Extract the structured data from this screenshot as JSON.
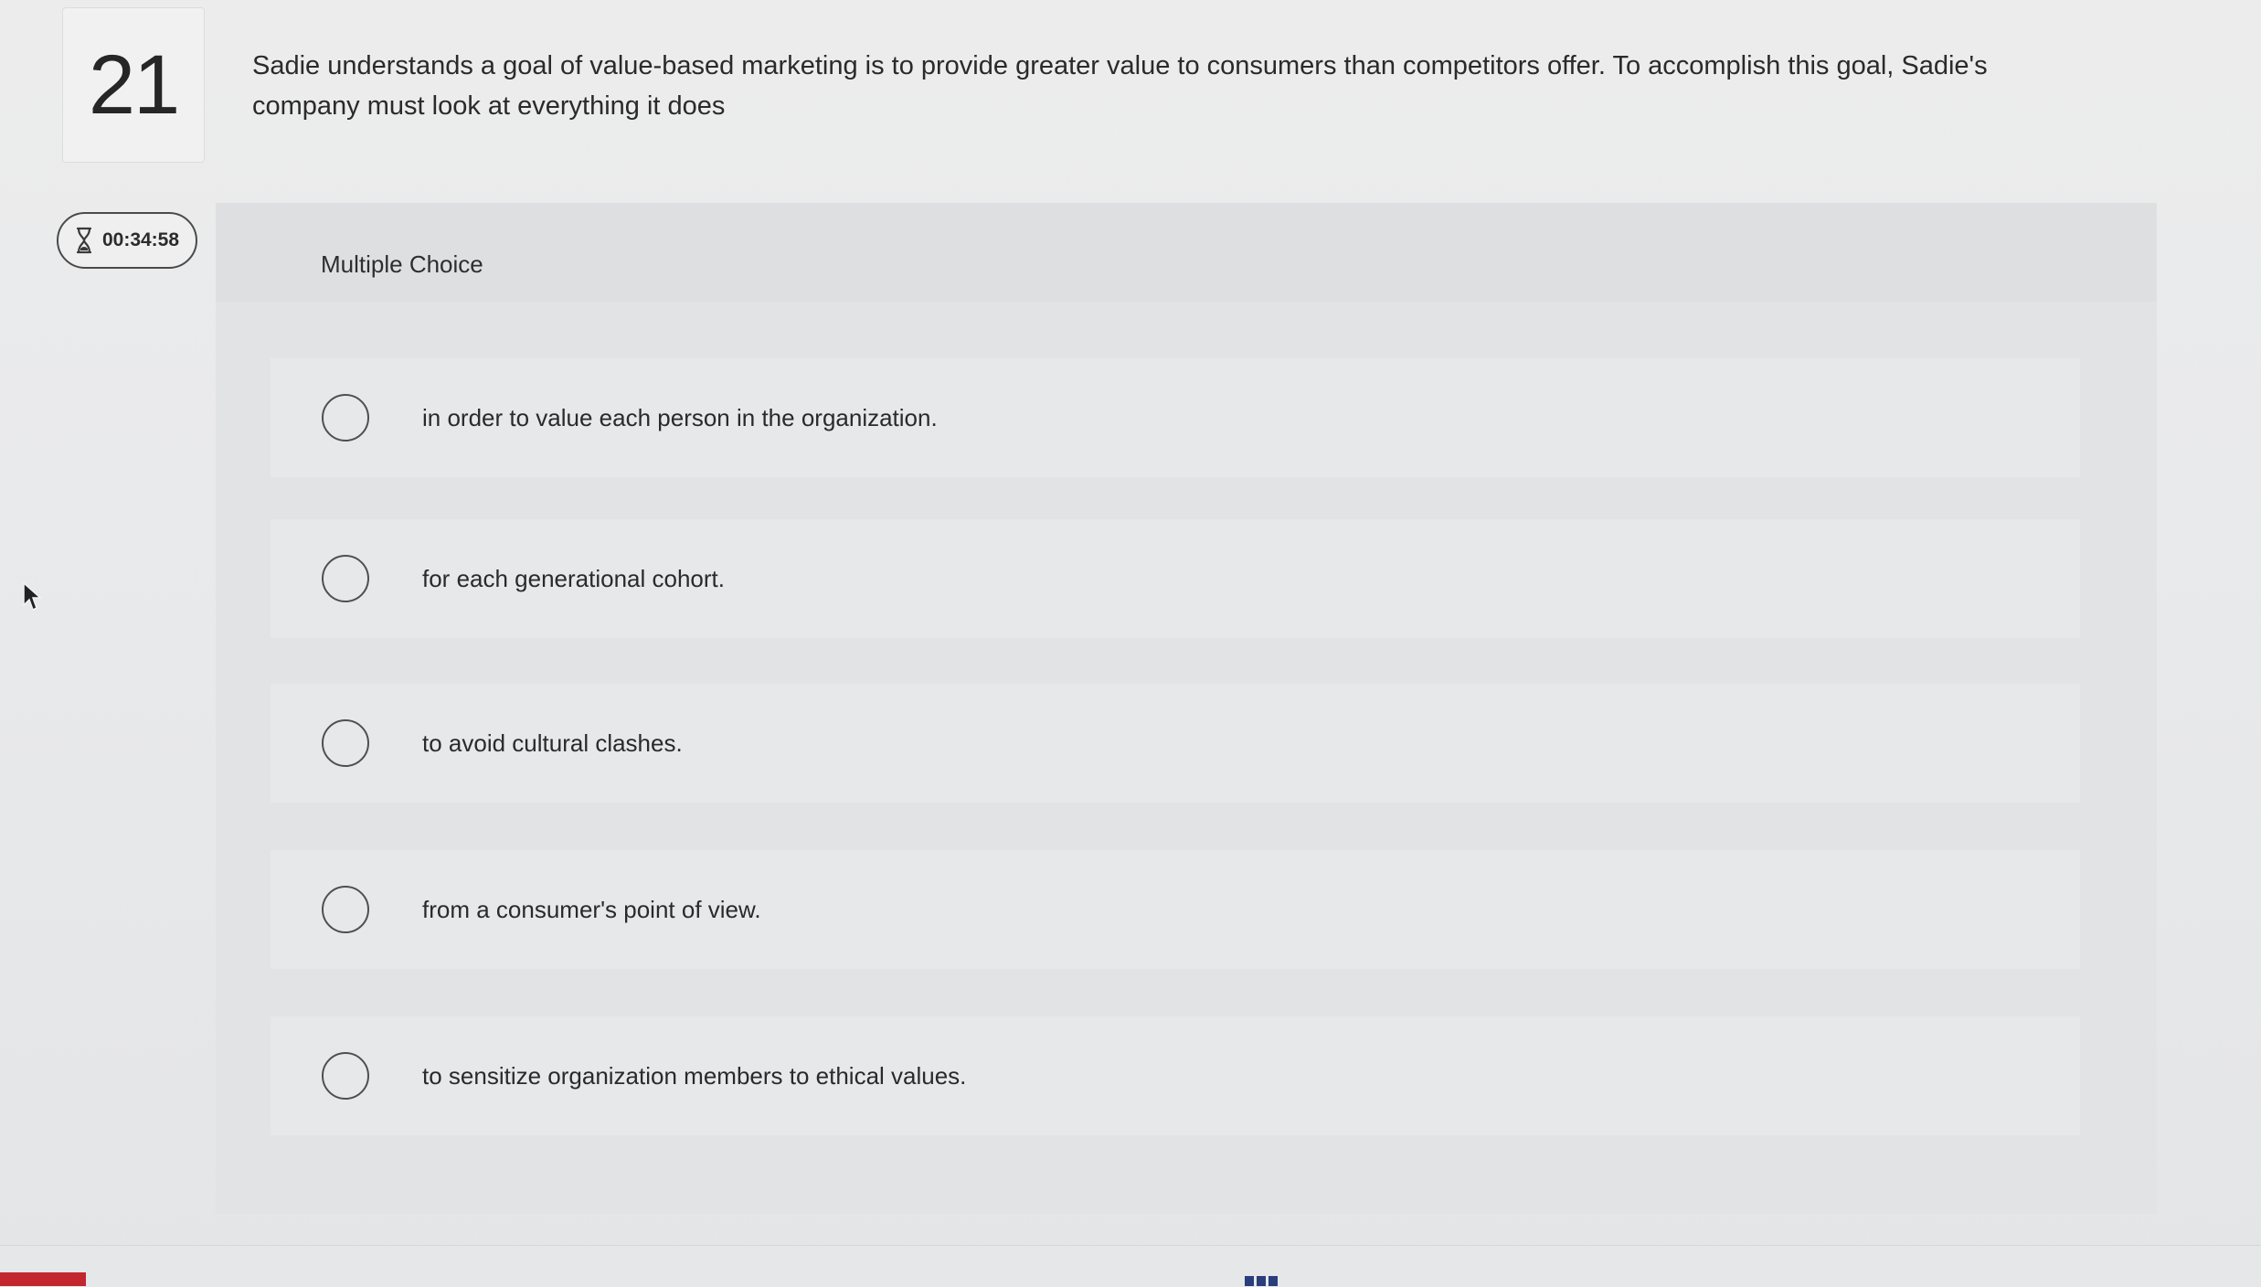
{
  "question": {
    "number": "21",
    "text": "Sadie understands a goal of value-based marketing is to provide greater value to consumers than competitors offer. To accomplish this goal, Sadie's company must look at everything it does"
  },
  "timer": {
    "icon": "hourglass-icon",
    "value": "00:34:58"
  },
  "card": {
    "type_label": "Multiple Choice",
    "options": [
      {
        "label": "in order to value each person in the organization.",
        "selected": false
      },
      {
        "label": "for each generational cohort.",
        "selected": false
      },
      {
        "label": "to avoid cultural clashes.",
        "selected": false
      },
      {
        "label": "from a consumer's point of view.",
        "selected": false
      },
      {
        "label": "to sensitize organization members to ethical values.",
        "selected": false
      }
    ]
  },
  "colors": {
    "brand": "#c2262e",
    "accent_blue": "#2a3e7c"
  }
}
